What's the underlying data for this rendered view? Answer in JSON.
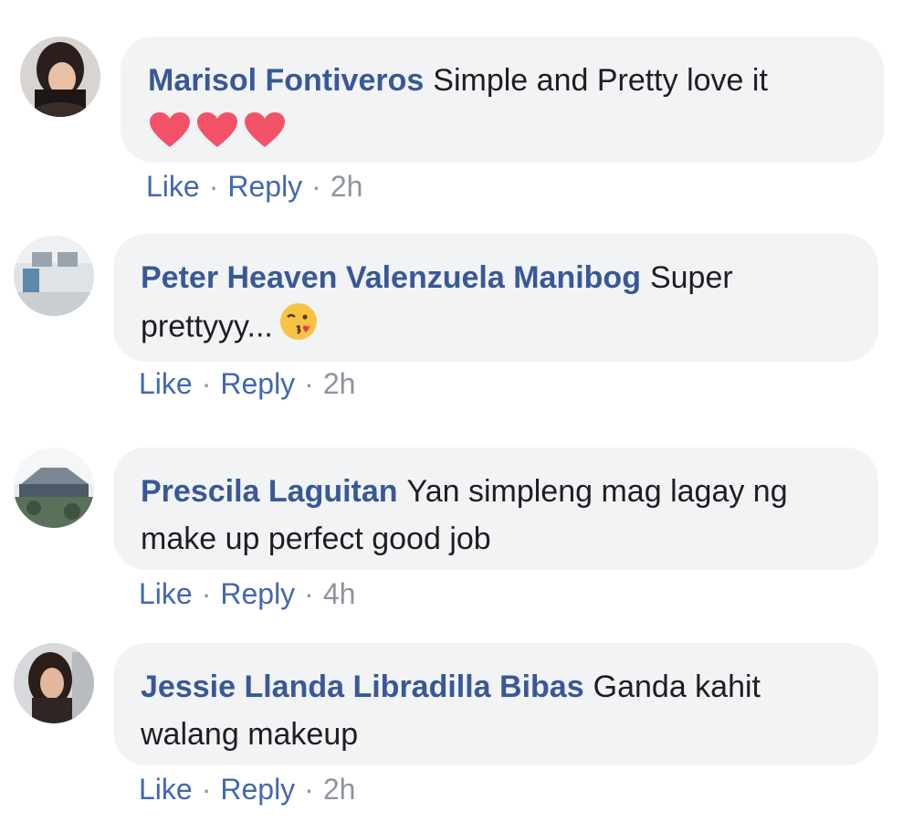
{
  "comments": [
    {
      "author": "Marisol Fontiveros",
      "text": "Simple and Pretty love it",
      "emoji": "❤❤❤",
      "like_label": "Like",
      "reply_label": "Reply",
      "separator": "·",
      "time": "2h"
    },
    {
      "author": "Peter Heaven Valenzuela Manibog",
      "text": "Super prettyyy...",
      "emoji": "😘",
      "like_label": "Like",
      "reply_label": "Reply",
      "separator": "·",
      "time": "2h"
    },
    {
      "author": "Prescila Laguitan",
      "text": "Yan simpleng mag lagay ng make up perfect good job",
      "like_label": "Like",
      "reply_label": "Reply",
      "separator": "·",
      "time": "4h"
    },
    {
      "author": "Jessie Llanda Libradilla Bibas",
      "text": "Ganda kahit walang makeup",
      "like_label": "Like",
      "reply_label": "Reply",
      "separator": "·",
      "time": "2h"
    }
  ],
  "colors": {
    "author": "#385898",
    "bubble": "#f2f3f5",
    "action_link": "#4267b2",
    "meta": "#8d949e",
    "heart": "#f25268"
  }
}
